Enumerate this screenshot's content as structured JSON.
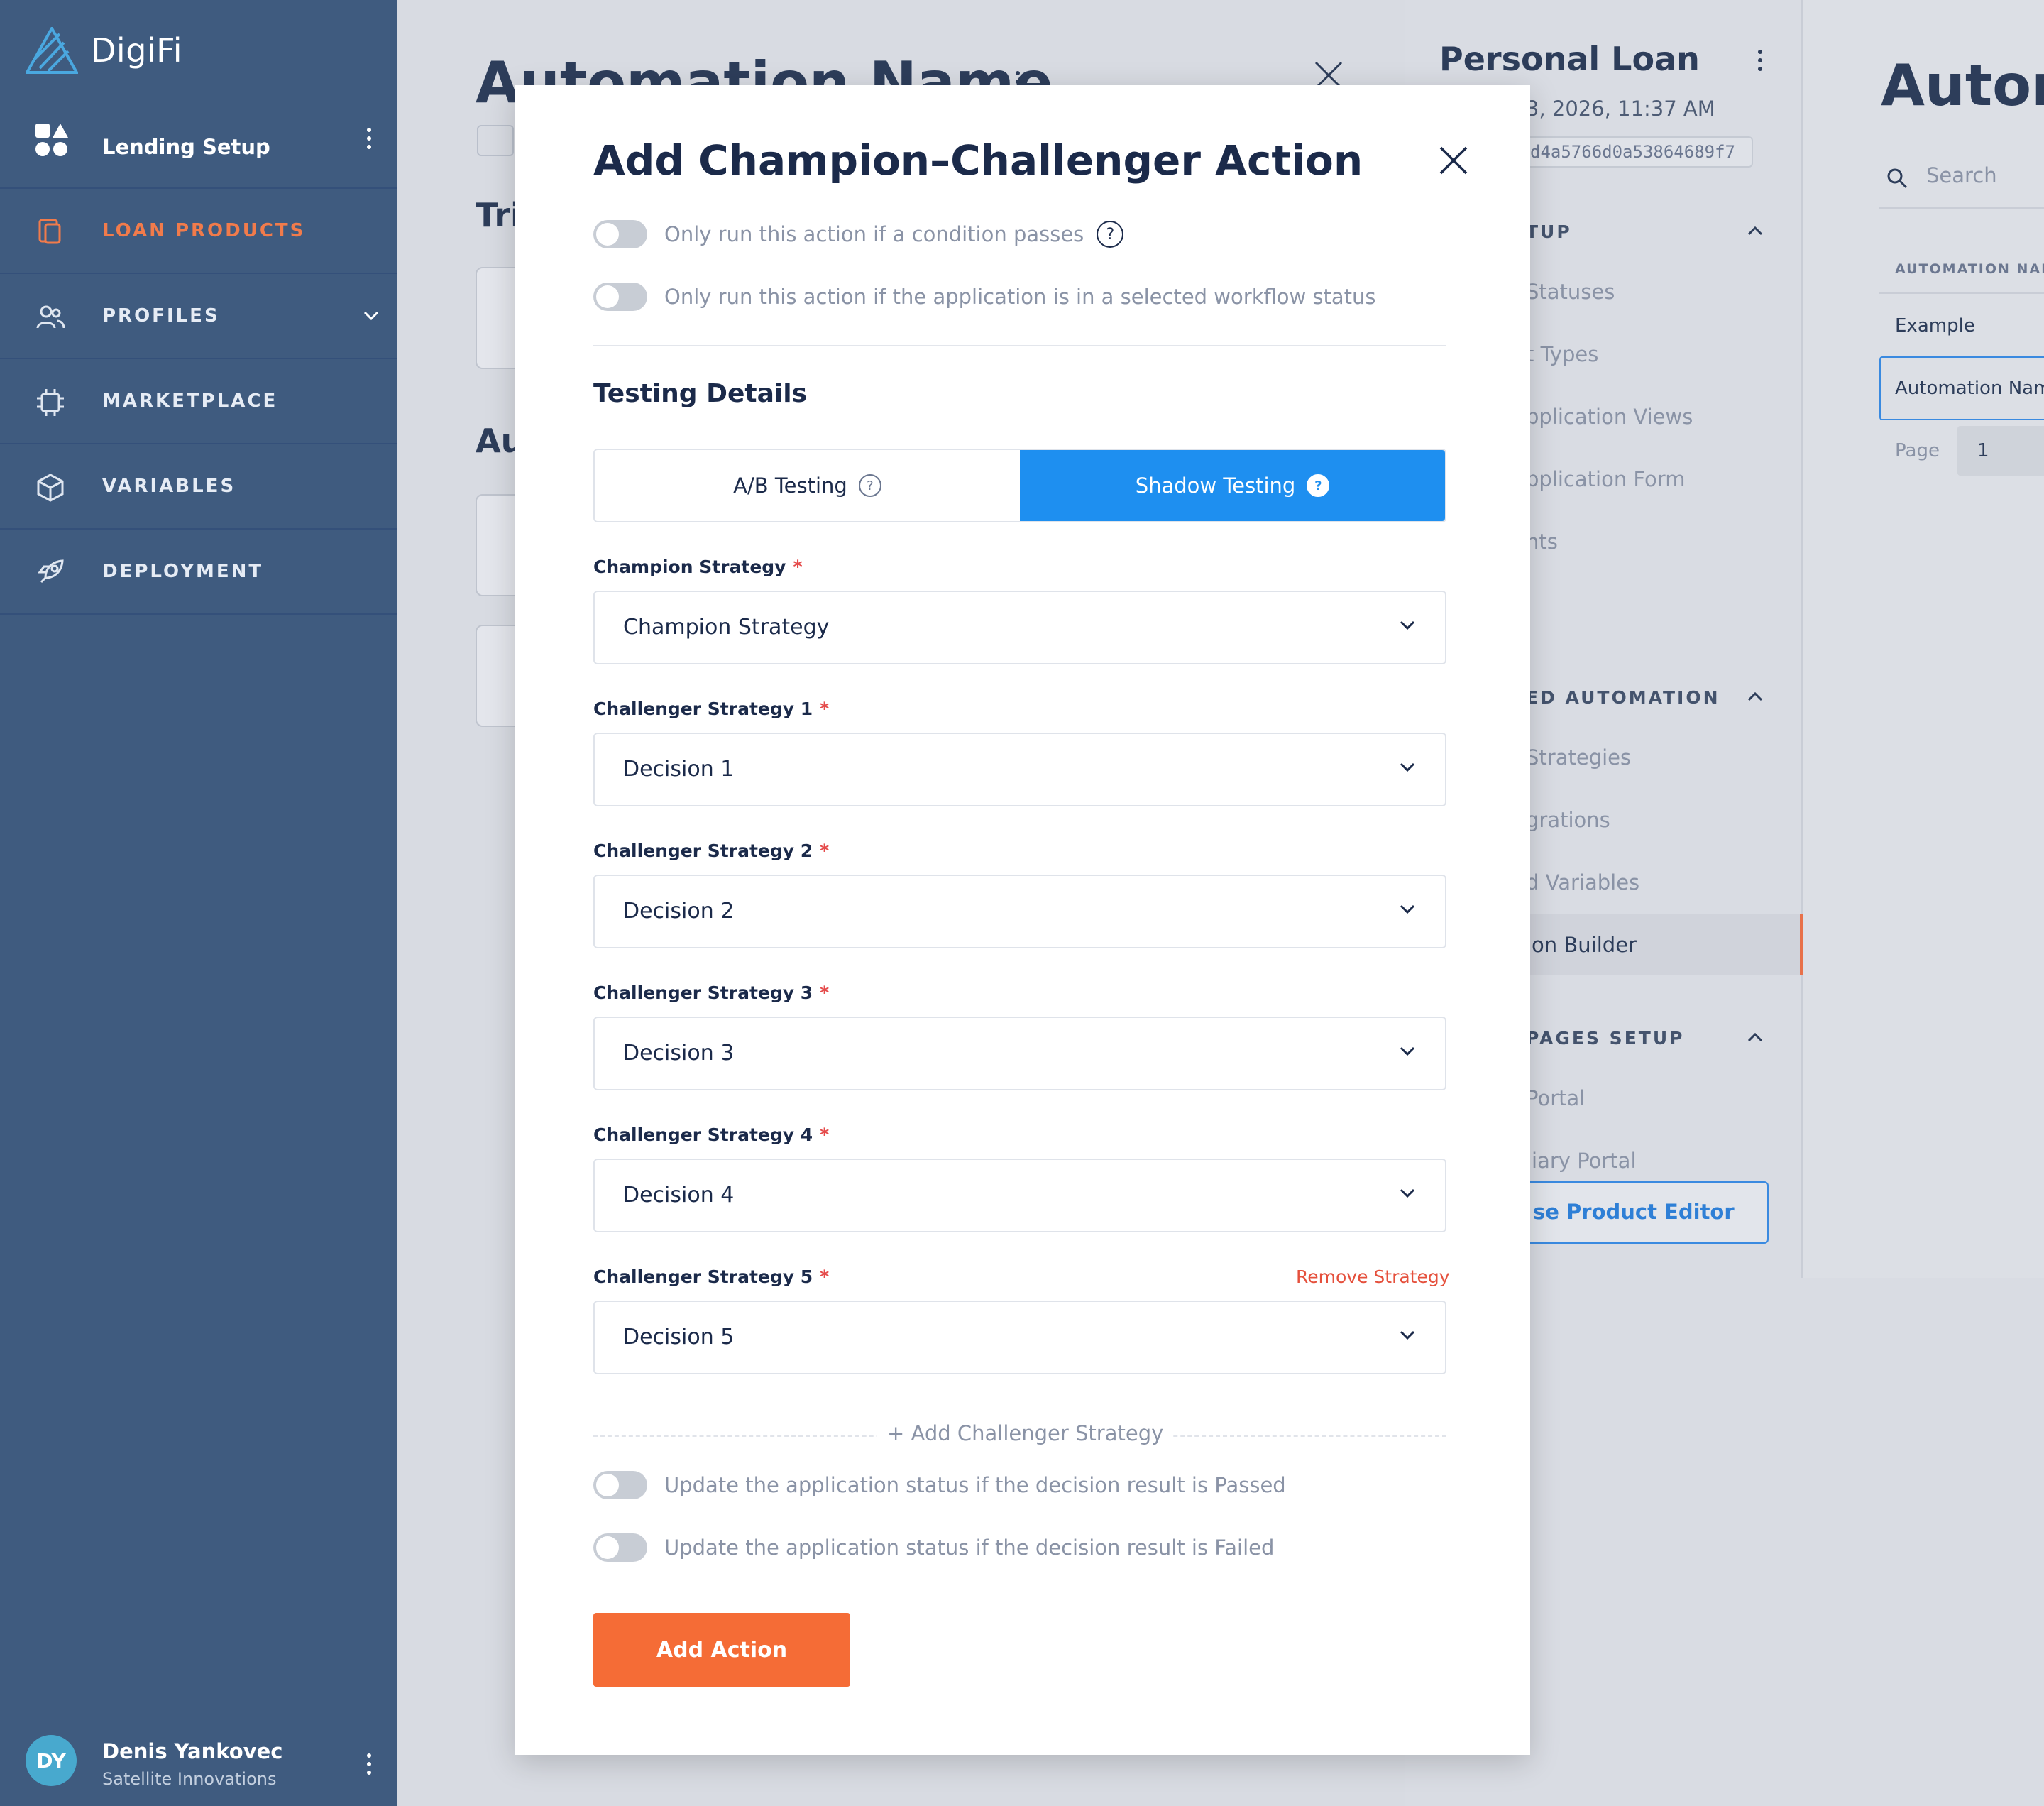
{
  "app": {
    "name": "DigiFi"
  },
  "sidebar": {
    "setup_label": "Lending Setup",
    "items": [
      {
        "label": "LOAN PRODUCTS",
        "icon": "loan-products-icon",
        "active": true
      },
      {
        "label": "PROFILES",
        "icon": "profiles-icon",
        "has_chevron": true
      },
      {
        "label": "MARKETPLACE",
        "icon": "marketplace-icon"
      },
      {
        "label": "VARIABLES",
        "icon": "variables-icon"
      },
      {
        "label": "DEPLOYMENT",
        "icon": "deployment-icon"
      }
    ],
    "user": {
      "initials": "DY",
      "name": "Denis Yankovec",
      "company": "Satellite Innovations"
    }
  },
  "background_main": {
    "title": "Automation Name",
    "section_1": "Tri",
    "section_2": "Au"
  },
  "background_product": {
    "title": "Personal Loan",
    "date": "3, 2026, 11:37 AM",
    "id": "d4a5766d0a53864689f7",
    "sections": [
      {
        "heading": "TUP",
        "items": [
          "Statuses",
          "t Types",
          "pplication Views",
          "pplication Form",
          "nts"
        ]
      },
      {
        "heading": "ED AUTOMATION",
        "items": [
          "Strategies",
          "grations",
          "d Variables",
          "ion Builder"
        ]
      },
      {
        "heading": "PAGES SETUP",
        "items": [
          "Portal",
          "liary Portal"
        ]
      }
    ],
    "editor_button": "se Product Editor"
  },
  "background_far": {
    "title": "Autom",
    "search_placeholder": "Search",
    "column_header": "AUTOMATION NAME",
    "rows": [
      "Example",
      "Automation Nam"
    ],
    "page_label": "Page",
    "page_value": "1"
  },
  "modal": {
    "title": "Add Champion–Challenger Action",
    "toggle_condition": "Only run this action if a condition passes",
    "toggle_status": "Only run this action if the application is in a selected workflow status",
    "section_title": "Testing Details",
    "tabs": [
      {
        "label": "A/B Testing",
        "active": false
      },
      {
        "label": "Shadow Testing",
        "active": true
      }
    ],
    "help_glyph": "?",
    "champion": {
      "label": "Champion Strategy",
      "value": "Champion Strategy"
    },
    "challengers": [
      {
        "label": "Challenger Strategy 1",
        "value": "Decision 1"
      },
      {
        "label": "Challenger Strategy 2",
        "value": "Decision 2"
      },
      {
        "label": "Challenger Strategy 3",
        "value": "Decision 3"
      },
      {
        "label": "Challenger Strategy 4",
        "value": "Decision 4"
      },
      {
        "label": "Challenger Strategy 5",
        "value": "Decision 5"
      }
    ],
    "required_mark": "*",
    "remove_strategy": "Remove Strategy",
    "add_challenger": "+ Add Challenger Strategy",
    "toggle_passed": "Update the application status if the decision result is Passed",
    "toggle_failed": "Update the application status if the decision result is Failed",
    "submit": "Add Action"
  },
  "colors": {
    "sidebar": "#3f5b7f",
    "accent_orange": "#f56c36",
    "primary_blue": "#1e8ff0",
    "required_red": "#e54b4b"
  }
}
